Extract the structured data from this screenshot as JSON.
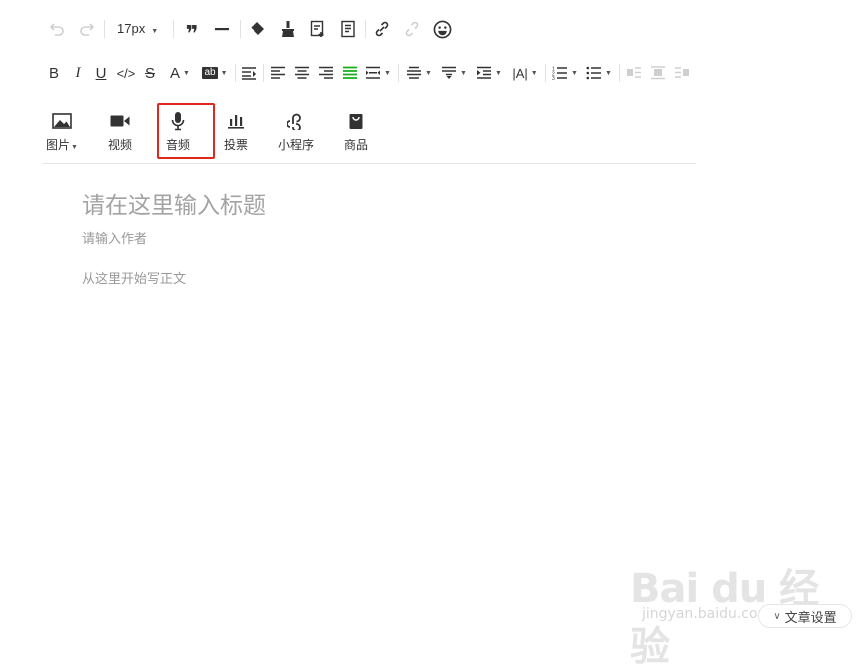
{
  "toolbar1": {
    "font_size": "17px",
    "icons": [
      "undo-icon",
      "redo-icon",
      "blockquote-icon",
      "horizontal-rule-icon",
      "eraser-icon",
      "format-painter-icon",
      "insert-template-icon",
      "document-icon",
      "link-icon",
      "unlink-icon",
      "emoji-icon"
    ]
  },
  "toolbar2": {
    "icons": [
      "bold-icon",
      "italic-icon",
      "underline-icon",
      "code-icon",
      "strikethrough-icon",
      "font-color-icon",
      "background-color-icon",
      "indent-icon",
      "align-left-icon",
      "align-center-icon",
      "align-right-icon",
      "align-justify-icon",
      "justify-both-icon",
      "line-height-icon",
      "paragraph-spacing-icon",
      "text-indent-icon",
      "letter-spacing-icon",
      "ordered-list-icon",
      "unordered-list-icon",
      "float-left-icon",
      "float-center-icon",
      "float-right-icon"
    ],
    "background_color_label": "ab"
  },
  "media": {
    "image": "图片",
    "video": "视频",
    "audio": "音频",
    "vote": "投票",
    "miniprogram": "小程序",
    "product": "商品"
  },
  "editor": {
    "title_placeholder": "请在这里输入标题",
    "author_placeholder": "请输入作者",
    "body_placeholder": "从这里开始写正文"
  },
  "watermark": {
    "logo": "Bai du 经验",
    "sub": "jingyan.baidu.com"
  },
  "settings_button": "文章设置",
  "colors": {
    "active_green": "#1aad19",
    "highlight_red": "#e0261f",
    "disabled": "#cfcfcf"
  }
}
